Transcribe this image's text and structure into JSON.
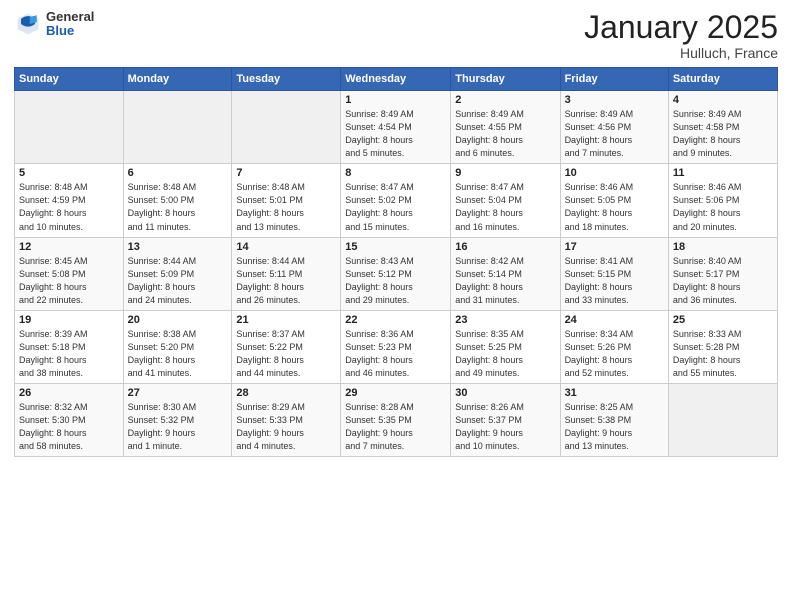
{
  "logo": {
    "general": "General",
    "blue": "Blue"
  },
  "title": "January 2025",
  "location": "Hulluch, France",
  "days_header": [
    "Sunday",
    "Monday",
    "Tuesday",
    "Wednesday",
    "Thursday",
    "Friday",
    "Saturday"
  ],
  "weeks": [
    [
      {
        "day": "",
        "info": ""
      },
      {
        "day": "",
        "info": ""
      },
      {
        "day": "",
        "info": ""
      },
      {
        "day": "1",
        "info": "Sunrise: 8:49 AM\nSunset: 4:54 PM\nDaylight: 8 hours\nand 5 minutes."
      },
      {
        "day": "2",
        "info": "Sunrise: 8:49 AM\nSunset: 4:55 PM\nDaylight: 8 hours\nand 6 minutes."
      },
      {
        "day": "3",
        "info": "Sunrise: 8:49 AM\nSunset: 4:56 PM\nDaylight: 8 hours\nand 7 minutes."
      },
      {
        "day": "4",
        "info": "Sunrise: 8:49 AM\nSunset: 4:58 PM\nDaylight: 8 hours\nand 9 minutes."
      }
    ],
    [
      {
        "day": "5",
        "info": "Sunrise: 8:48 AM\nSunset: 4:59 PM\nDaylight: 8 hours\nand 10 minutes."
      },
      {
        "day": "6",
        "info": "Sunrise: 8:48 AM\nSunset: 5:00 PM\nDaylight: 8 hours\nand 11 minutes."
      },
      {
        "day": "7",
        "info": "Sunrise: 8:48 AM\nSunset: 5:01 PM\nDaylight: 8 hours\nand 13 minutes."
      },
      {
        "day": "8",
        "info": "Sunrise: 8:47 AM\nSunset: 5:02 PM\nDaylight: 8 hours\nand 15 minutes."
      },
      {
        "day": "9",
        "info": "Sunrise: 8:47 AM\nSunset: 5:04 PM\nDaylight: 8 hours\nand 16 minutes."
      },
      {
        "day": "10",
        "info": "Sunrise: 8:46 AM\nSunset: 5:05 PM\nDaylight: 8 hours\nand 18 minutes."
      },
      {
        "day": "11",
        "info": "Sunrise: 8:46 AM\nSunset: 5:06 PM\nDaylight: 8 hours\nand 20 minutes."
      }
    ],
    [
      {
        "day": "12",
        "info": "Sunrise: 8:45 AM\nSunset: 5:08 PM\nDaylight: 8 hours\nand 22 minutes."
      },
      {
        "day": "13",
        "info": "Sunrise: 8:44 AM\nSunset: 5:09 PM\nDaylight: 8 hours\nand 24 minutes."
      },
      {
        "day": "14",
        "info": "Sunrise: 8:44 AM\nSunset: 5:11 PM\nDaylight: 8 hours\nand 26 minutes."
      },
      {
        "day": "15",
        "info": "Sunrise: 8:43 AM\nSunset: 5:12 PM\nDaylight: 8 hours\nand 29 minutes."
      },
      {
        "day": "16",
        "info": "Sunrise: 8:42 AM\nSunset: 5:14 PM\nDaylight: 8 hours\nand 31 minutes."
      },
      {
        "day": "17",
        "info": "Sunrise: 8:41 AM\nSunset: 5:15 PM\nDaylight: 8 hours\nand 33 minutes."
      },
      {
        "day": "18",
        "info": "Sunrise: 8:40 AM\nSunset: 5:17 PM\nDaylight: 8 hours\nand 36 minutes."
      }
    ],
    [
      {
        "day": "19",
        "info": "Sunrise: 8:39 AM\nSunset: 5:18 PM\nDaylight: 8 hours\nand 38 minutes."
      },
      {
        "day": "20",
        "info": "Sunrise: 8:38 AM\nSunset: 5:20 PM\nDaylight: 8 hours\nand 41 minutes."
      },
      {
        "day": "21",
        "info": "Sunrise: 8:37 AM\nSunset: 5:22 PM\nDaylight: 8 hours\nand 44 minutes."
      },
      {
        "day": "22",
        "info": "Sunrise: 8:36 AM\nSunset: 5:23 PM\nDaylight: 8 hours\nand 46 minutes."
      },
      {
        "day": "23",
        "info": "Sunrise: 8:35 AM\nSunset: 5:25 PM\nDaylight: 8 hours\nand 49 minutes."
      },
      {
        "day": "24",
        "info": "Sunrise: 8:34 AM\nSunset: 5:26 PM\nDaylight: 8 hours\nand 52 minutes."
      },
      {
        "day": "25",
        "info": "Sunrise: 8:33 AM\nSunset: 5:28 PM\nDaylight: 8 hours\nand 55 minutes."
      }
    ],
    [
      {
        "day": "26",
        "info": "Sunrise: 8:32 AM\nSunset: 5:30 PM\nDaylight: 8 hours\nand 58 minutes."
      },
      {
        "day": "27",
        "info": "Sunrise: 8:30 AM\nSunset: 5:32 PM\nDaylight: 9 hours\nand 1 minute."
      },
      {
        "day": "28",
        "info": "Sunrise: 8:29 AM\nSunset: 5:33 PM\nDaylight: 9 hours\nand 4 minutes."
      },
      {
        "day": "29",
        "info": "Sunrise: 8:28 AM\nSunset: 5:35 PM\nDaylight: 9 hours\nand 7 minutes."
      },
      {
        "day": "30",
        "info": "Sunrise: 8:26 AM\nSunset: 5:37 PM\nDaylight: 9 hours\nand 10 minutes."
      },
      {
        "day": "31",
        "info": "Sunrise: 8:25 AM\nSunset: 5:38 PM\nDaylight: 9 hours\nand 13 minutes."
      },
      {
        "day": "",
        "info": ""
      }
    ]
  ]
}
